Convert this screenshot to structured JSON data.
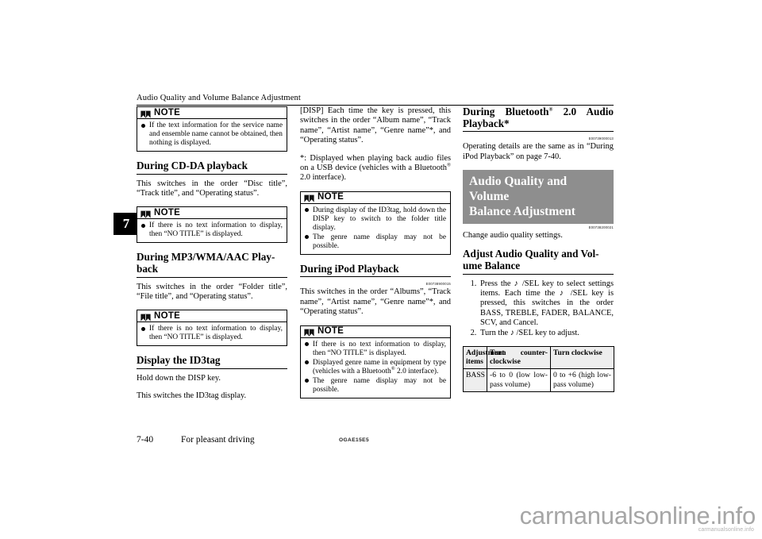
{
  "page": {
    "running_header": "Audio Quality and Volume Balance Adjustment",
    "chapter_tab": "7",
    "footer": {
      "page_number": "7-40",
      "section_name": "For pleasant driving",
      "document_code": "OGAE15E5"
    },
    "watermark": {
      "big": "carmanualsonline.info",
      "small": "carmanualsonline.info"
    }
  },
  "left_column": {
    "note_1": {
      "title": "NOTE",
      "items": [
        "If the text information for the service name and ensemble name cannot be obtained, then nothing is displayed."
      ]
    },
    "heading_cd_da": "During CD-DA playback",
    "para_cd_da": "This switches in the order “Disc title”, “Track title”, and “Operating status”.",
    "note_2": {
      "title": "NOTE",
      "items": [
        "If there is no text information to display, then “NO TITLE” is displayed."
      ]
    },
    "heading_mp3_line1": "During  MP3/WMA/AAC  Play-",
    "heading_mp3_line2": "back",
    "para_mp3": "This switches in the order “Folder title”, “File title”, and “Operating status”.",
    "note_3": {
      "title": "NOTE",
      "items": [
        "If there is no text information to display, then “NO TITLE” is displayed."
      ]
    },
    "heading_id3tag": "Display the ID3tag",
    "para_id3tag_1": "Hold down the DISP key.",
    "para_id3tag_2": "This switches the ID3tag display."
  },
  "middle_column": {
    "para_disp": "[DISP] Each time the key is pressed, this switches in the order “Album name”, “Track name”, “Artist name”, “Genre name”*, and “Operating status”.",
    "para_footnote_pre": "*: Displayed when playing back audio files on a USB device (vehicles with a Bluetooth",
    "para_footnote_post": " 2.0 interface).",
    "note_4": {
      "title": "NOTE",
      "items": [
        "During display of the ID3tag, hold down the DISP key to switch to the folder title display.",
        "The genre name display may not be possible."
      ]
    },
    "heading_ipod": "During iPod Playback",
    "refcode_ipod": "E00738900015",
    "para_ipod": "This switches in the order “Albums”, “Track name”, “Artist name”, “Genre name”*, and “Operating status”.",
    "note_5": {
      "title": "NOTE",
      "items_rich": [
        {
          "pre": "If there is no text information to display, then “NO TITLE” is displayed.",
          "reg": false,
          "post": ""
        },
        {
          "pre": "Displayed genre name in equipment by type (vehicles with a Bluetooth",
          "reg": true,
          "post": " 2.0 interface)."
        },
        {
          "pre": "The genre name display may not be possible.",
          "reg": false,
          "post": ""
        }
      ]
    }
  },
  "right_column": {
    "heading_bt_pre": "During Bluetooth",
    "heading_bt_post": " 2.0 Audio Playback*",
    "refcode_bt": "E00739000013",
    "para_bt": "Operating details are the same as in “During iPod Playback” on page 7-40.",
    "banner_line1": "Audio Quality and Volume",
    "banner_line2": "Balance Adjustment",
    "refcode_banner": "E00738200021",
    "para_change": "Change audio quality settings.",
    "heading_adjust_line1": "Adjust Audio Quality and Vol-",
    "heading_adjust_line2": "ume Balance",
    "steps": [
      {
        "lines": [
          "Press the ♪ /SEL key to select settings items.",
          "Each time the ♪ /SEL key is pressed, this switches in the order BASS, TREBLE, FADER, BALANCE, SCV, and Cancel."
        ]
      },
      {
        "lines": [
          "Turn the ♪ /SEL key to adjust."
        ]
      }
    ],
    "table": {
      "headers": [
        "Adjustment items",
        "Turn counter-clockwise",
        "Turn clockwise"
      ],
      "rows": [
        {
          "item": "BASS",
          "ccw": "-6 to 0 (low low-pass volume)",
          "cw": "0 to +6 (high low-pass volume)"
        }
      ]
    }
  }
}
